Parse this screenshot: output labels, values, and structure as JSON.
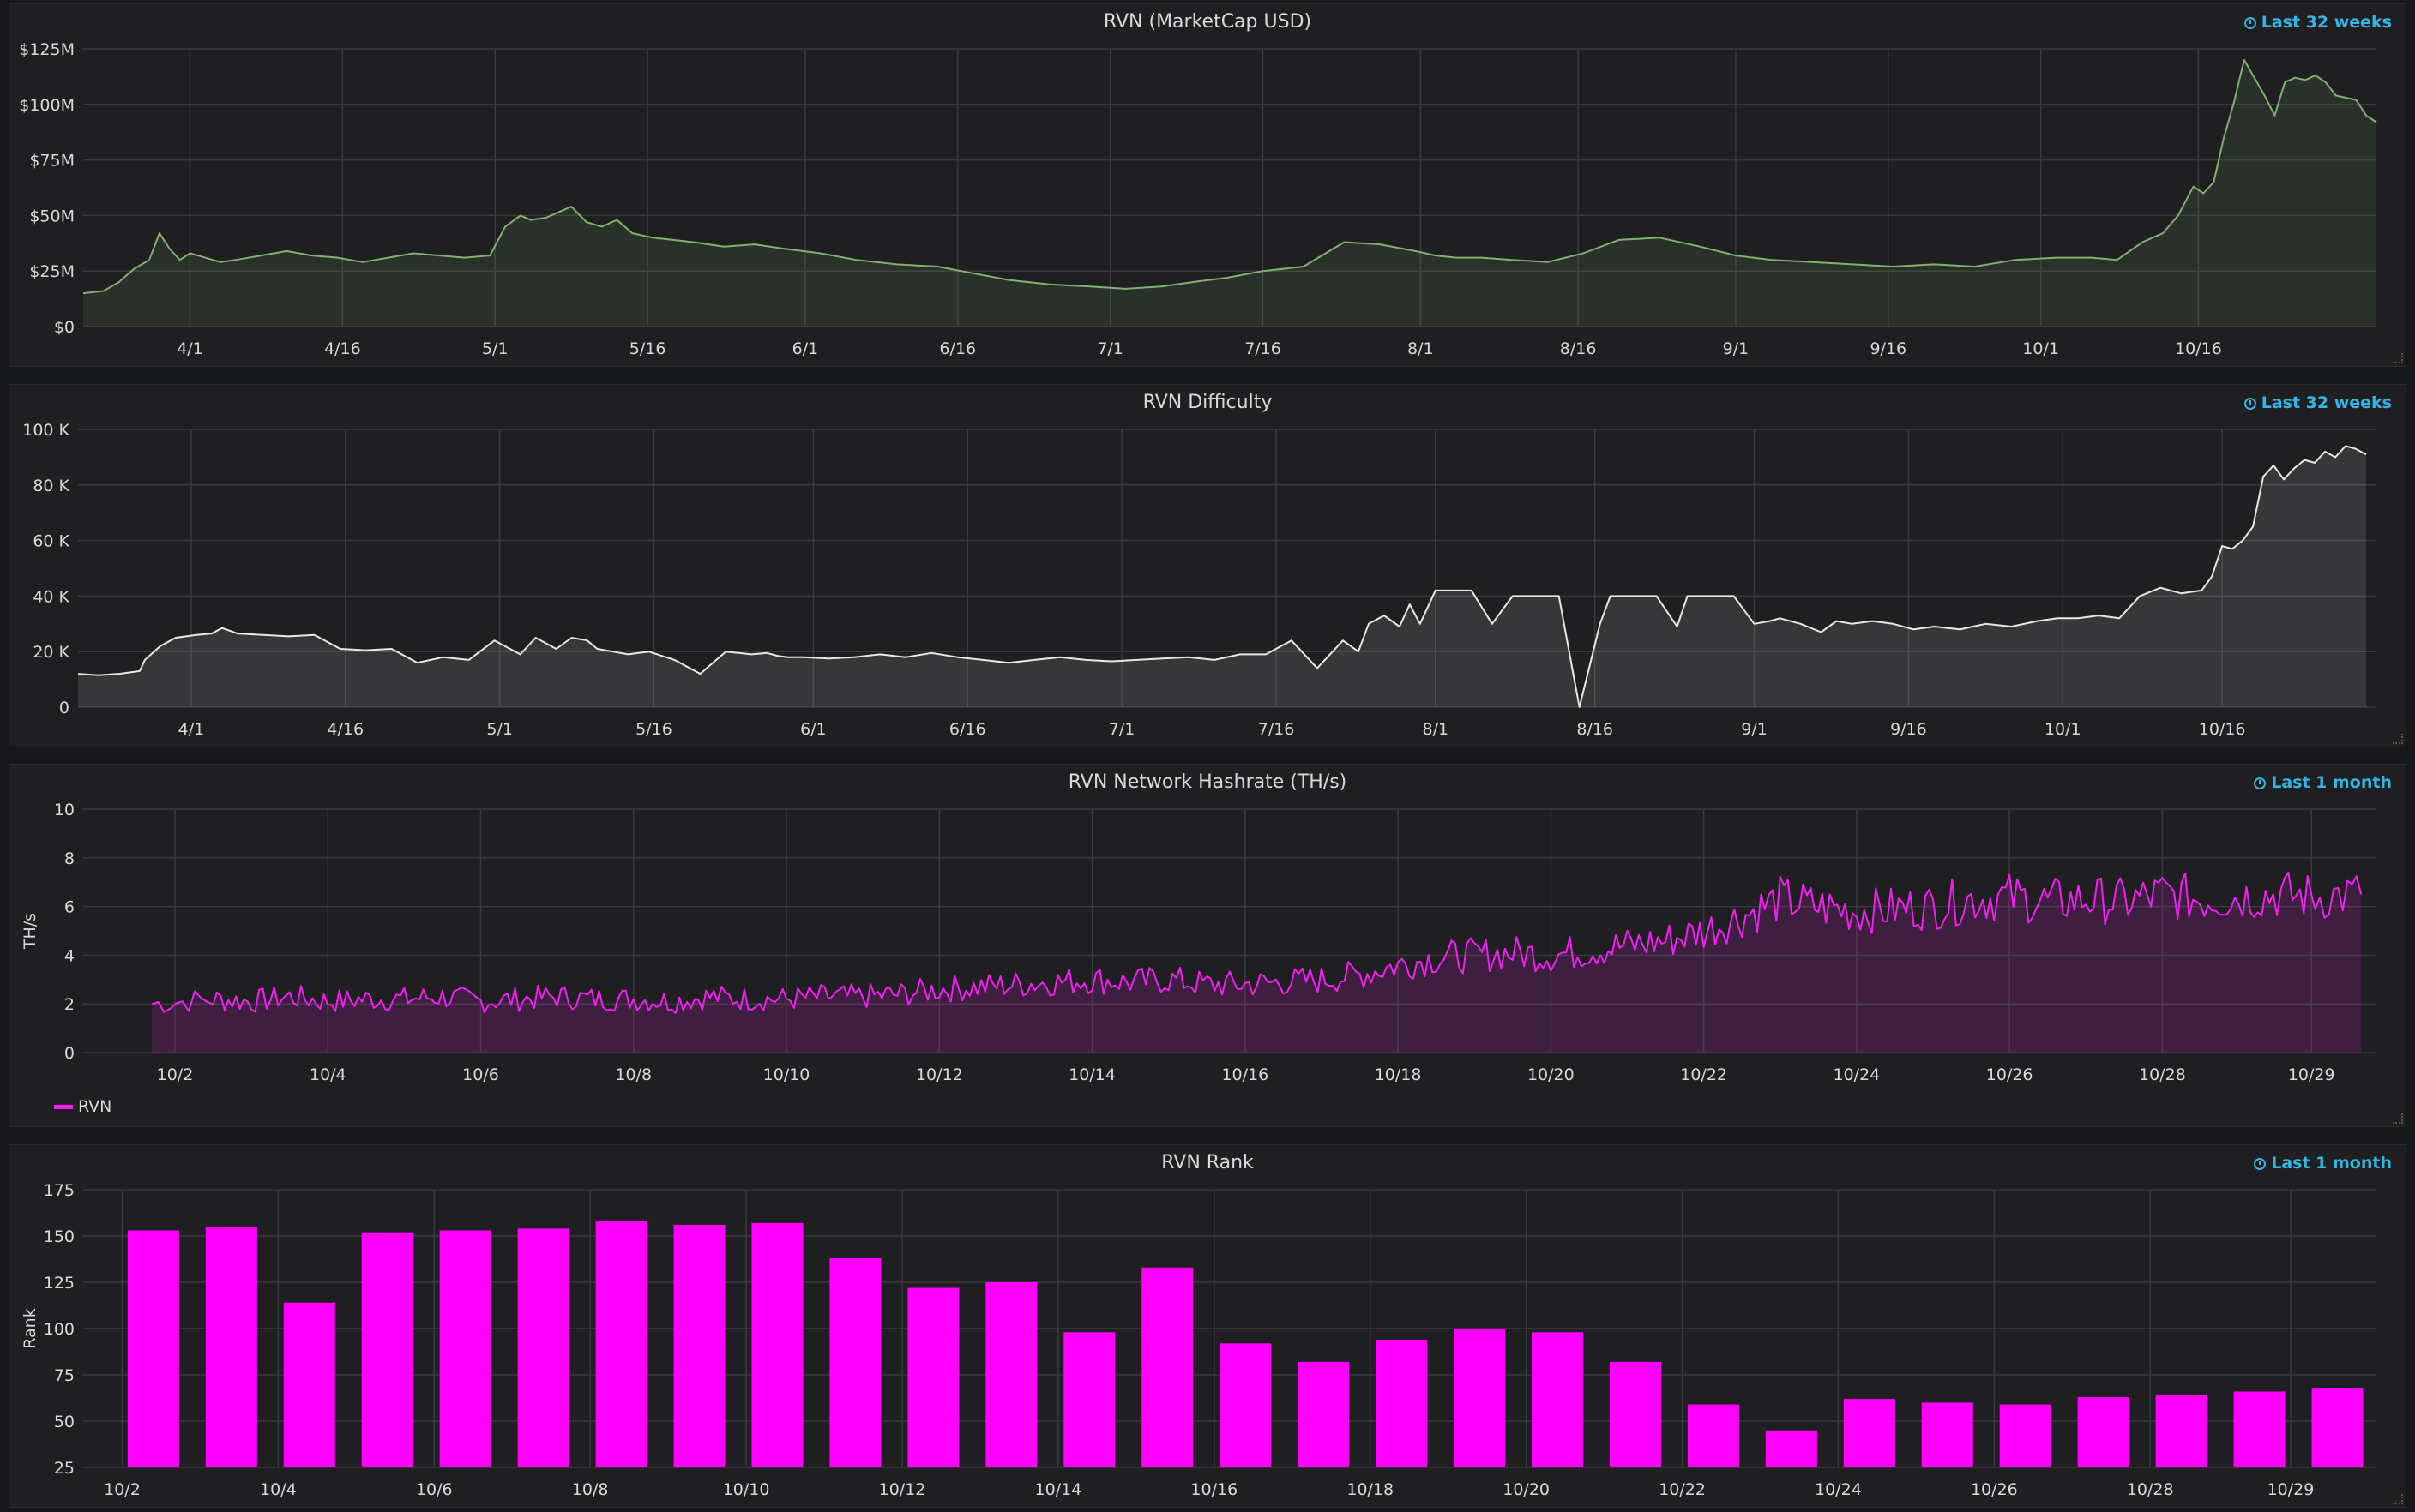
{
  "panels": [
    {
      "title": "RVN (MarketCap USD)",
      "range": "Last 32 weeks"
    },
    {
      "title": "RVN Difficulty",
      "range": "Last 32 weeks"
    },
    {
      "title": "RVN Network Hashrate (TH/s)",
      "range": "Last 1 month",
      "legend": "RVN"
    },
    {
      "title": "RVN Rank",
      "range": "Last 1 month"
    }
  ],
  "colors": {
    "marketcap": "#7eb26d",
    "difficulty": "#e8e8e8",
    "hashrate": "#f21ff2",
    "rank": "#ff00ff",
    "grid": "#3a3a3d"
  },
  "chart_data": [
    {
      "type": "area",
      "title": "RVN (MarketCap USD)",
      "ylim": [
        0,
        125000000
      ],
      "yticks": [
        0,
        25000000,
        50000000,
        75000000,
        100000000,
        125000000
      ],
      "ytick_labels": [
        "$0",
        "$25M",
        "$50M",
        "$75M",
        "$100M",
        "$125M"
      ],
      "xlim": [
        0,
        224
      ],
      "xticks": [
        21,
        51,
        81,
        111,
        142,
        172,
        202,
        232,
        263,
        294,
        325,
        355,
        385,
        416
      ],
      "xtick_labels": [
        "4/1",
        "4/16",
        "5/1",
        "5/16",
        "6/1",
        "6/16",
        "7/1",
        "7/16",
        "8/1",
        "8/16",
        "9/1",
        "9/16",
        "10/1",
        "10/16"
      ],
      "x_offset_days": 0,
      "series": [
        {
          "x": [
            0,
            4,
            7,
            10,
            13,
            15,
            17,
            19,
            21,
            24,
            27,
            30,
            35,
            40,
            45,
            50,
            55,
            60,
            65,
            70,
            75,
            80,
            83,
            86,
            88,
            91,
            93,
            96,
            99,
            102,
            105,
            108,
            112,
            116,
            120,
            126,
            132,
            138,
            145,
            152,
            160,
            168,
            175,
            182,
            190,
            198,
            205,
            212,
            218,
            225,
            232,
            240,
            248,
            255,
            262,
            266,
            270,
            275,
            281,
            288,
            295,
            302,
            310,
            318,
            325,
            332,
            340,
            348,
            356,
            364,
            372,
            380,
            388,
            395,
            400,
            405,
            409,
            412,
            415,
            417,
            419,
            421,
            423,
            425,
            427,
            429,
            431,
            433,
            435,
            437,
            439,
            441,
            443,
            445,
            447,
            449,
            451
          ],
          "y": [
            15000000,
            16000000,
            20000000,
            26000000,
            30000000,
            42000000,
            35000000,
            30000000,
            33000000,
            31000000,
            29000000,
            30000000,
            32000000,
            34000000,
            32000000,
            31000000,
            29000000,
            31000000,
            33000000,
            32000000,
            31000000,
            32000000,
            45000000,
            50000000,
            48000000,
            49000000,
            51000000,
            54000000,
            47000000,
            45000000,
            48000000,
            42000000,
            40000000,
            39000000,
            38000000,
            36000000,
            37000000,
            35000000,
            33000000,
            30000000,
            28000000,
            27000000,
            24000000,
            21000000,
            19000000,
            18000000,
            17000000,
            18000000,
            20000000,
            22000000,
            25000000,
            27000000,
            38000000,
            37000000,
            34000000,
            32000000,
            31000000,
            31000000,
            30000000,
            29000000,
            33000000,
            39000000,
            40000000,
            36000000,
            32000000,
            30000000,
            29000000,
            28000000,
            27000000,
            28000000,
            27000000,
            30000000,
            31000000,
            31000000,
            30000000,
            38000000,
            42000000,
            50000000,
            63000000,
            60000000,
            65000000,
            85000000,
            101000000,
            120000000,
            112000000,
            104000000,
            95000000,
            110000000,
            112000000,
            111000000,
            113000000,
            110000000,
            104000000,
            103000000,
            102000000,
            95000000,
            92000000
          ]
        }
      ]
    },
    {
      "type": "area",
      "title": "RVN Difficulty",
      "ylim": [
        0,
        100000
      ],
      "yticks": [
        0,
        20000,
        40000,
        60000,
        80000,
        100000
      ],
      "ytick_labels": [
        "0",
        "20 K",
        "40 K",
        "60 K",
        "80 K",
        "100 K"
      ],
      "xtick_labels": [
        "4/1",
        "4/16",
        "5/1",
        "5/16",
        "6/1",
        "6/16",
        "7/1",
        "7/16",
        "8/1",
        "8/16",
        "9/1",
        "9/16",
        "10/1",
        "10/16"
      ],
      "xticks": [
        21,
        51,
        81,
        111,
        142,
        172,
        202,
        232,
        263,
        294,
        325,
        355,
        385,
        416
      ],
      "series": [
        {
          "x": [
            -1,
            3,
            7,
            11,
            12,
            15,
            18,
            22,
            25,
            27,
            30,
            35,
            40,
            45,
            50,
            55,
            60,
            65,
            70,
            75,
            80,
            85,
            88,
            92,
            95,
            98,
            100,
            103,
            106,
            110,
            115,
            120,
            125,
            130,
            133,
            135,
            137,
            140,
            145,
            150,
            155,
            160,
            165,
            170,
            175,
            180,
            185,
            190,
            195,
            200,
            205,
            210,
            215,
            220,
            225,
            230,
            235,
            240,
            245,
            248,
            250,
            253,
            256,
            258,
            260,
            263,
            266,
            268,
            270,
            274,
            278,
            280,
            283,
            287,
            291,
            295,
            297,
            299,
            301,
            303,
            306,
            310,
            312,
            314,
            317,
            321,
            325,
            328,
            330,
            334,
            338,
            341,
            344,
            348,
            352,
            356,
            360,
            365,
            370,
            375,
            380,
            384,
            388,
            392,
            396,
            400,
            404,
            408,
            412,
            414,
            416,
            418,
            420,
            422,
            424,
            426,
            428,
            430,
            432,
            434,
            436,
            438,
            440,
            442,
            444
          ],
          "y": [
            12000,
            11500,
            12000,
            13000,
            17000,
            22000,
            25000,
            26000,
            26500,
            28500,
            26500,
            26000,
            25500,
            26000,
            21000,
            20500,
            21000,
            16000,
            18000,
            17000,
            24000,
            19000,
            25000,
            21000,
            25000,
            24000,
            21000,
            20000,
            19000,
            20000,
            17000,
            12000,
            20000,
            19000,
            19500,
            18500,
            18000,
            18000,
            17500,
            18000,
            19000,
            18000,
            19500,
            18000,
            17000,
            16000,
            17000,
            18000,
            17000,
            16500,
            17000,
            17500,
            18000,
            17000,
            19000,
            19000,
            24000,
            14000,
            24000,
            20000,
            30000,
            33000,
            29000,
            37000,
            30000,
            42000,
            42000,
            42000,
            42000,
            30000,
            40000,
            40000,
            40000,
            40000,
            0,
            30000,
            40000,
            40000,
            40000,
            40000,
            40000,
            29000,
            40000,
            40000,
            40000,
            40000,
            30000,
            31000,
            32000,
            30000,
            27000,
            31000,
            30000,
            31000,
            30000,
            28000,
            29000,
            28000,
            30000,
            29000,
            31000,
            32000,
            32000,
            33000,
            32000,
            40000,
            43000,
            41000,
            42000,
            47000,
            58000,
            57000,
            60000,
            65000,
            83000,
            87000,
            82000,
            86000,
            89000,
            88000,
            92000,
            90000,
            94000,
            93000,
            91000
          ]
        }
      ]
    },
    {
      "type": "line",
      "title": "RVN Network Hashrate (TH/s)",
      "ylabel": "TH/s",
      "ylim": [
        0,
        10
      ],
      "yticks": [
        0,
        2,
        4,
        6,
        8,
        10
      ],
      "ytick_labels": [
        "0",
        "2",
        "4",
        "6",
        "8",
        "10"
      ],
      "xtick_labels": [
        "10/2",
        "10/4",
        "10/6",
        "10/8",
        "10/10",
        "10/12",
        "10/14",
        "10/16",
        "10/18",
        "10/20",
        "10/22",
        "10/24",
        "10/26",
        "10/28",
        "10/29"
      ],
      "xticks": [
        2,
        4,
        6,
        8,
        10,
        12,
        14,
        16,
        18,
        20,
        22,
        24,
        26,
        28,
        29.95
      ],
      "series": [
        {
          "name": "RVN",
          "x": [
            1.7,
            2.5,
            3,
            3.5,
            4,
            4.5,
            5,
            5.5,
            6,
            6.5,
            7,
            7.5,
            8,
            8.5,
            9,
            9.5,
            10,
            10.5,
            11,
            11.5,
            12,
            12.5,
            13,
            13.5,
            14,
            14.5,
            15,
            15.5,
            16,
            16.5,
            17,
            17.5,
            18,
            18.5,
            19,
            19.5,
            20,
            20.5,
            21,
            21.5,
            22,
            22.5,
            23,
            23.5,
            24,
            24.5,
            25,
            25.5,
            26,
            26.5,
            27,
            27.5,
            28,
            28.5,
            29,
            29.5,
            30,
            30.6
          ],
          "y": [
            2.0,
            2.2,
            2.1,
            2.3,
            2.1,
            2.2,
            2.2,
            2.3,
            2.1,
            2.2,
            2.3,
            2.2,
            2.2,
            2.1,
            2.3,
            2.2,
            2.2,
            2.3,
            2.3,
            2.4,
            2.6,
            2.7,
            2.8,
            2.9,
            3.0,
            2.9,
            3.0,
            2.8,
            2.8,
            2.9,
            3.0,
            3.2,
            3.6,
            3.9,
            4.0,
            4.1,
            4.0,
            4.2,
            4.4,
            4.6,
            5.0,
            5.6,
            6.3,
            6.0,
            5.8,
            5.9,
            6.0,
            6.3,
            6.4,
            6.2,
            6.3,
            6.2,
            6.5,
            6.3,
            6.4,
            6.5,
            6.4,
            6.5
          ]
        }
      ]
    },
    {
      "type": "bar",
      "title": "RVN Rank",
      "ylabel": "Rank",
      "ylim": [
        25,
        175
      ],
      "yticks": [
        25,
        50,
        75,
        100,
        125,
        150,
        175
      ],
      "ytick_labels": [
        "25",
        "50",
        "75",
        "100",
        "125",
        "150",
        "175"
      ],
      "xtick_labels": [
        "10/2",
        "10/4",
        "10/6",
        "10/8",
        "10/10",
        "10/12",
        "10/14",
        "10/16",
        "10/18",
        "10/20",
        "10/22",
        "10/24",
        "10/26",
        "10/28",
        "10/29"
      ],
      "xticks": [
        2,
        4,
        6,
        8,
        10,
        12,
        14,
        16,
        18,
        20,
        22,
        24,
        26,
        28,
        29.8
      ],
      "series": [
        {
          "x": [
            2.4,
            3.4,
            4.4,
            5.4,
            6.4,
            7.4,
            8.4,
            9.4,
            10.4,
            11.4,
            12.4,
            13.4,
            14.4,
            15.4,
            16.4,
            17.4,
            18.4,
            19.4,
            20.4,
            21.4,
            22.4,
            23.4,
            24.4,
            25.4,
            26.4,
            27.4,
            28.4,
            29.4,
            30.4
          ],
          "values": [
            153,
            155,
            114,
            152,
            153,
            154,
            158,
            156,
            157,
            138,
            122,
            125,
            98,
            133,
            92,
            82,
            94,
            100,
            98,
            82,
            59,
            45,
            62,
            60,
            59,
            63,
            64,
            66,
            68
          ]
        }
      ]
    }
  ]
}
